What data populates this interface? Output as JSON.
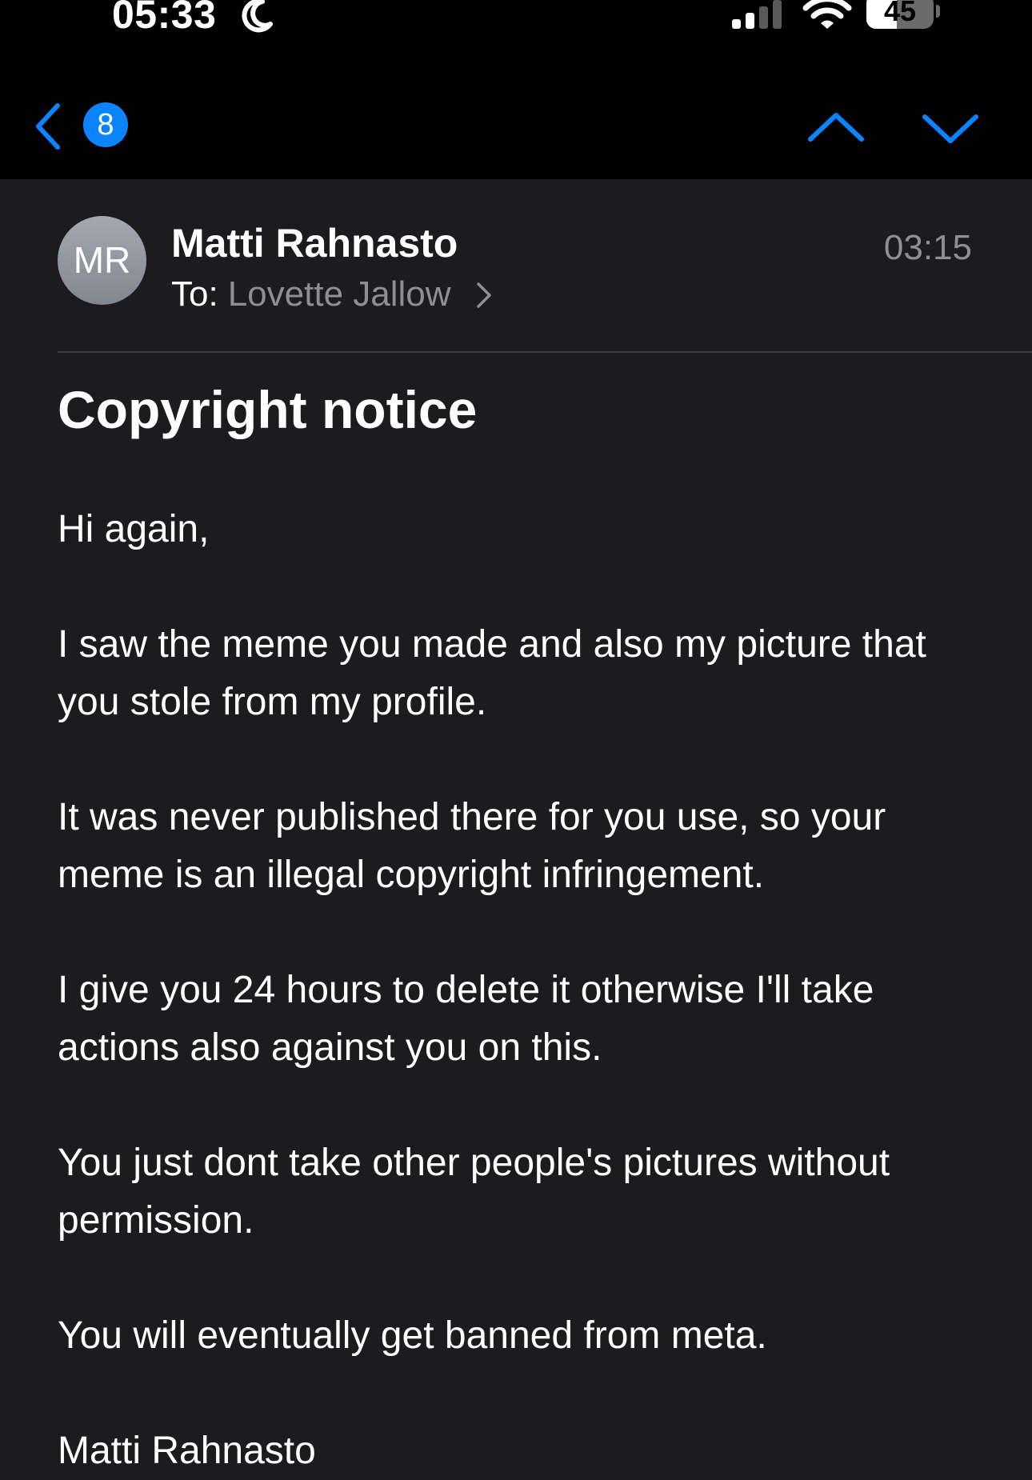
{
  "status_bar": {
    "time": "05:33",
    "battery_percent": "45",
    "battery_level": 0.45,
    "icons": [
      "moon-icon",
      "signal-icon",
      "wifi-icon",
      "battery-icon"
    ]
  },
  "nav": {
    "unread_count": "8",
    "icons": [
      "back-chevron-icon",
      "chevron-up-icon",
      "chevron-down-icon"
    ]
  },
  "message": {
    "avatar_initials": "MR",
    "sender": "Matti Rahnasto",
    "to_label": "To:",
    "recipient": "Lovette Jallow",
    "time": "03:15",
    "subject": "Copyright notice",
    "body": [
      "Hi again,",
      "I saw the meme you made and also my picture that you stole from my profile.",
      "It was never published there for you use, so your meme is an illegal copyright infringement.",
      "I give you 24 hours to delete it otherwise I'll take actions also against you on this.",
      "You just dont take other people's pictures without permission.",
      "You will eventually get banned from meta.",
      "Matti Rahnasto"
    ]
  },
  "colors": {
    "background": "#1c1c1e",
    "bar_background": "#000000",
    "accent": "#0a84ff",
    "secondary_text": "#8e8e93",
    "divider": "#3a3a3c"
  }
}
